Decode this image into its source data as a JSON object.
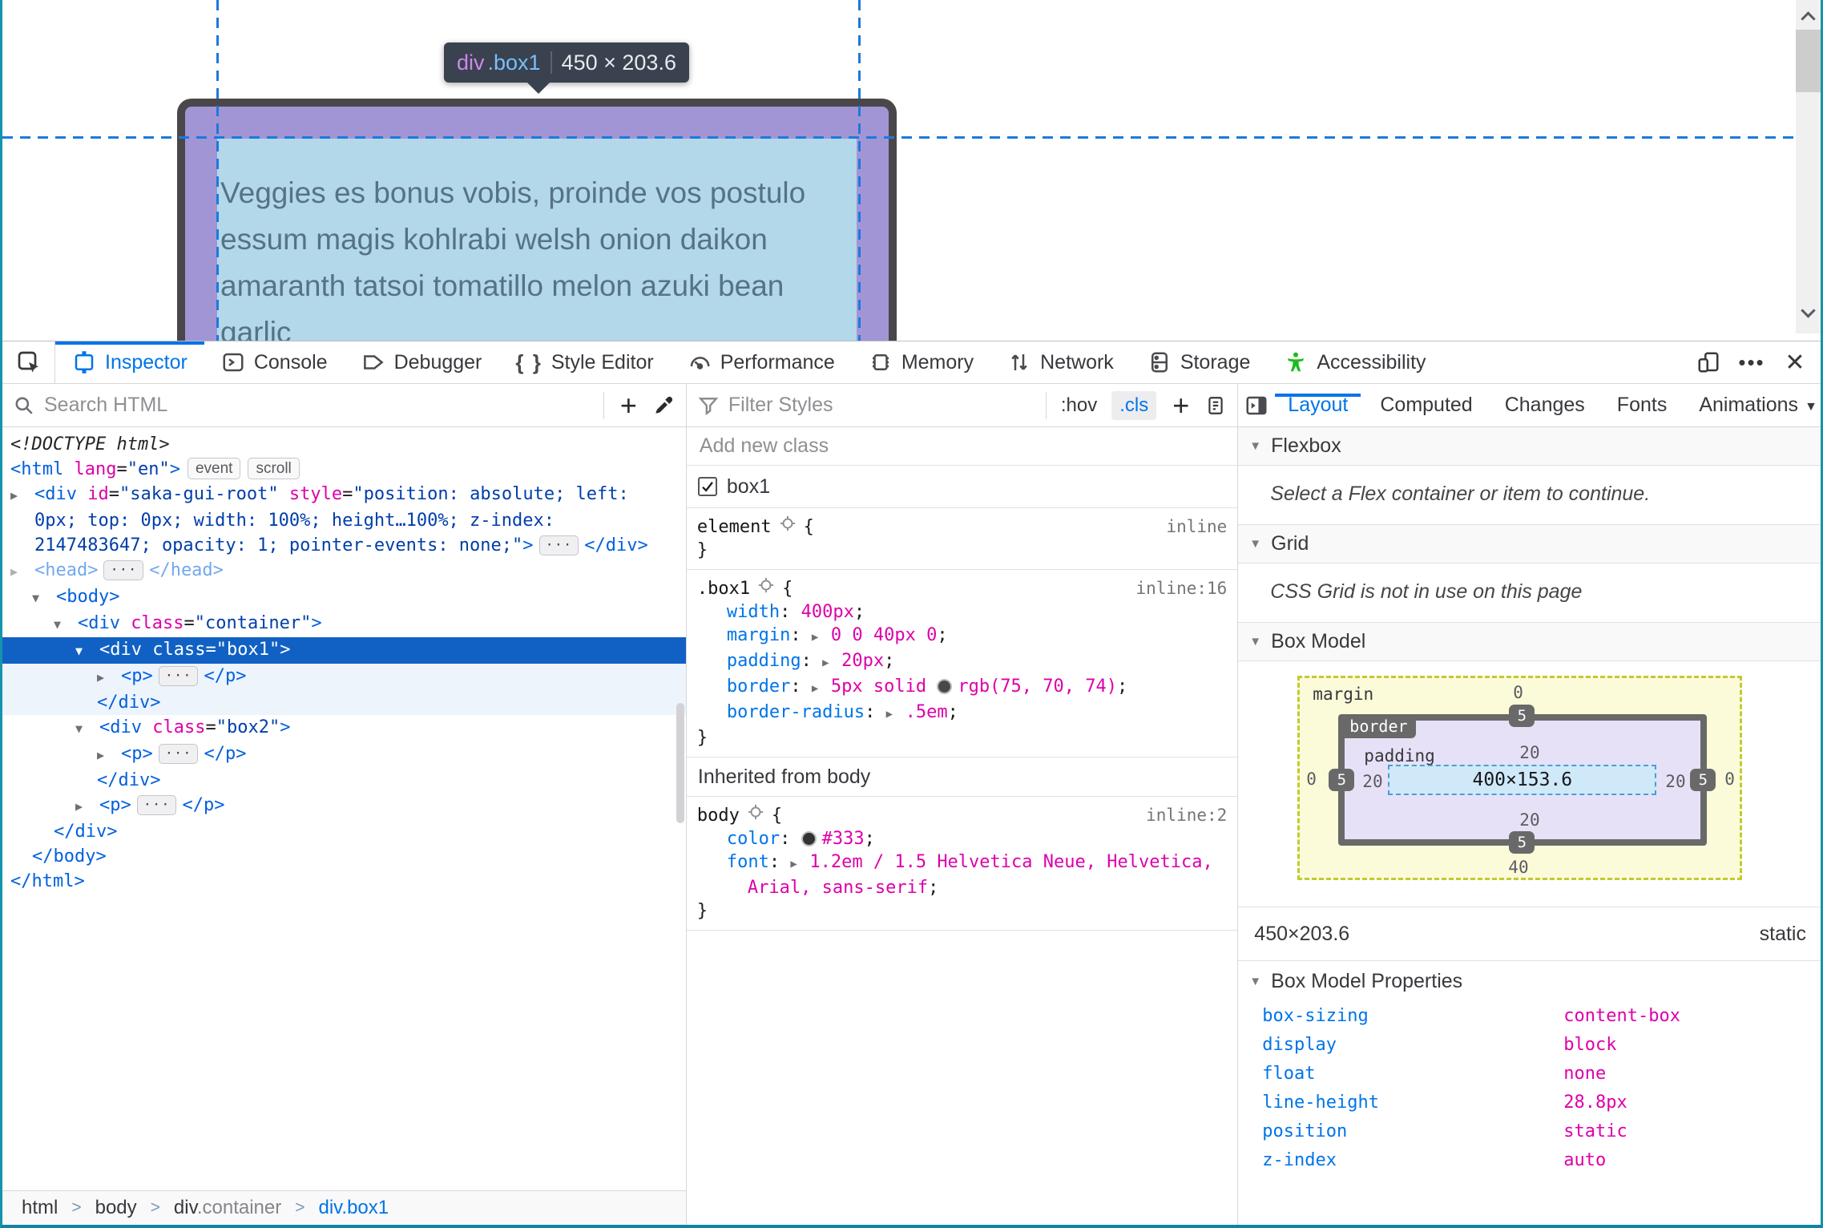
{
  "viewport": {
    "tooltip": {
      "tag": "div",
      "cls": ".box1",
      "sep": "|",
      "dims": "450 × 203.6"
    },
    "page_text_lines": [
      "Veggies es bonus vobis, proinde vos postulo",
      "essum magis kohlrabi welsh onion daikon",
      "amaranth tatsoi tomatillo melon azuki bean",
      "garlic"
    ]
  },
  "toolbox_tabs": {
    "items": [
      {
        "id": "inspector",
        "label": "Inspector",
        "active": true
      },
      {
        "id": "console",
        "label": "Console"
      },
      {
        "id": "debugger",
        "label": "Debugger"
      },
      {
        "id": "style-editor",
        "label": "Style Editor"
      },
      {
        "id": "performance",
        "label": "Performance"
      },
      {
        "id": "memory",
        "label": "Memory"
      },
      {
        "id": "network",
        "label": "Network"
      },
      {
        "id": "storage",
        "label": "Storage"
      },
      {
        "id": "accessibility",
        "label": "Accessibility"
      }
    ],
    "overflow_dots": "•••",
    "close": "✕"
  },
  "markup": {
    "search_placeholder": "Search HTML",
    "tree": [
      {
        "indent": 0,
        "arrow": null,
        "tokens": [
          {
            "t": "doctype",
            "v": "<!DOCTYPE html>"
          }
        ]
      },
      {
        "indent": 0,
        "arrow": null,
        "tokens": [
          {
            "t": "tag",
            "v": "<html"
          },
          {
            "t": "attr",
            "v": " lang"
          },
          {
            "t": "plain",
            "v": "="
          },
          {
            "t": "val",
            "v": "\"en\""
          },
          {
            "t": "tag",
            "v": ">"
          },
          {
            "t": "badge",
            "v": "event"
          },
          {
            "t": "badge",
            "v": "scroll"
          }
        ]
      },
      {
        "indent": 0,
        "arrow": "closed",
        "tokens": [
          {
            "t": "tag",
            "v": "<div"
          },
          {
            "t": "attr",
            "v": " id"
          },
          {
            "t": "plain",
            "v": "="
          },
          {
            "t": "val",
            "v": "\"saka-gui-root\""
          },
          {
            "t": "attr",
            "v": " style"
          },
          {
            "t": "plain",
            "v": "="
          },
          {
            "t": "val",
            "v": "\"position: absolute; left: 0px; top: 0px; width: 100%; height…100%; z-index: 2147483647; opacity: 1; pointer-events: none;\""
          },
          {
            "t": "tag",
            "v": ">"
          },
          {
            "t": "pill",
            "v": "···"
          },
          {
            "t": "tag",
            "v": "</div>"
          }
        ]
      },
      {
        "indent": 0,
        "arrow": "closed",
        "dim": true,
        "tokens": [
          {
            "t": "tag",
            "v": "<head>"
          },
          {
            "t": "pill",
            "v": "···"
          },
          {
            "t": "tag",
            "v": "</head>"
          }
        ]
      },
      {
        "indent": 1,
        "arrow": "open",
        "tokens": [
          {
            "t": "tag",
            "v": "<body>"
          }
        ]
      },
      {
        "indent": 2,
        "arrow": "open",
        "tokens": [
          {
            "t": "tag",
            "v": "<div"
          },
          {
            "t": "attr",
            "v": " class"
          },
          {
            "t": "plain",
            "v": "="
          },
          {
            "t": "val",
            "v": "\"container\""
          },
          {
            "t": "tag",
            "v": ">"
          }
        ]
      },
      {
        "indent": 3,
        "arrow": "open",
        "state": "selected",
        "tokens": [
          {
            "t": "tag",
            "v": "<div"
          },
          {
            "t": "attr",
            "v": " class"
          },
          {
            "t": "plain",
            "v": "="
          },
          {
            "t": "val",
            "v": "\"box1\""
          },
          {
            "t": "tag",
            "v": ">"
          }
        ]
      },
      {
        "indent": 4,
        "arrow": "closed",
        "state": "child",
        "tokens": [
          {
            "t": "tag",
            "v": "<p>"
          },
          {
            "t": "pill",
            "v": "···"
          },
          {
            "t": "tag",
            "v": "</p>"
          }
        ]
      },
      {
        "indent": 4,
        "arrow": null,
        "state": "child",
        "tokens": [
          {
            "t": "tag",
            "v": "</div>"
          }
        ]
      },
      {
        "indent": 3,
        "arrow": "open",
        "tokens": [
          {
            "t": "tag",
            "v": "<div"
          },
          {
            "t": "attr",
            "v": " class"
          },
          {
            "t": "plain",
            "v": "="
          },
          {
            "t": "val",
            "v": "\"box2\""
          },
          {
            "t": "tag",
            "v": ">"
          }
        ]
      },
      {
        "indent": 4,
        "arrow": "closed",
        "tokens": [
          {
            "t": "tag",
            "v": "<p>"
          },
          {
            "t": "pill",
            "v": "···"
          },
          {
            "t": "tag",
            "v": "</p>"
          }
        ]
      },
      {
        "indent": 4,
        "arrow": null,
        "tokens": [
          {
            "t": "tag",
            "v": "</div>"
          }
        ]
      },
      {
        "indent": 3,
        "arrow": "closed",
        "tokens": [
          {
            "t": "tag",
            "v": "<p>"
          },
          {
            "t": "pill",
            "v": "···"
          },
          {
            "t": "tag",
            "v": "</p>"
          }
        ]
      },
      {
        "indent": 2,
        "arrow": null,
        "tokens": [
          {
            "t": "tag",
            "v": "</div>"
          }
        ]
      },
      {
        "indent": 1,
        "arrow": null,
        "tokens": [
          {
            "t": "tag",
            "v": "</body>"
          }
        ]
      },
      {
        "indent": 0,
        "arrow": null,
        "tokens": [
          {
            "t": "tag",
            "v": "</html>"
          }
        ]
      }
    ],
    "breadcrumb": [
      {
        "parts": [
          {
            "v": "html",
            "c": "dark"
          }
        ]
      },
      {
        "parts": [
          {
            "v": "body",
            "c": "dark"
          }
        ]
      },
      {
        "parts": [
          {
            "v": "div",
            "c": "dark"
          },
          {
            "v": ".container",
            "c": "gray"
          }
        ]
      },
      {
        "parts": [
          {
            "v": "div.box1",
            "c": "blue"
          }
        ]
      }
    ],
    "breadcrumb_sep": ">"
  },
  "rules": {
    "filter_placeholder": "Filter Styles",
    "hov_label": ":hov",
    "cls_label": ".cls",
    "add_class_placeholder": "Add new class",
    "class_toggle_label": "box1",
    "sections": [
      {
        "type": "rule",
        "selector": "element",
        "meta": "inline",
        "decls": []
      },
      {
        "type": "rule",
        "selector": ".box1",
        "meta": "inline:16",
        "decls": [
          {
            "name": "width",
            "parts": [
              {
                "text": "400px"
              }
            ]
          },
          {
            "name": "margin",
            "arrow": true,
            "parts": [
              {
                "text": "0 0 40px 0"
              }
            ]
          },
          {
            "name": "padding",
            "arrow": true,
            "parts": [
              {
                "text": "20px"
              }
            ]
          },
          {
            "name": "border",
            "arrow": true,
            "parts": [
              {
                "text": "5px solid "
              },
              {
                "swatch": "#4b464a"
              },
              {
                "text": "rgb(75, 70, 74)"
              }
            ]
          },
          {
            "name": "border-radius",
            "arrow": true,
            "parts": [
              {
                "text": ".5em"
              }
            ]
          }
        ]
      },
      {
        "type": "header",
        "text": "Inherited from body"
      },
      {
        "type": "rule",
        "selector": "body",
        "meta": "inline:2",
        "decls": [
          {
            "name": "color",
            "parts": [
              {
                "swatch": "#333333"
              },
              {
                "text": "#333"
              }
            ]
          },
          {
            "name": "font",
            "arrow": true,
            "parts": [
              {
                "text": "1.2em / 1.5 Helvetica Neue, Helvetica, Arial, sans-serif"
              }
            ]
          }
        ]
      }
    ]
  },
  "layout": {
    "tabs": [
      "Layout",
      "Computed",
      "Changes",
      "Fonts",
      "Animations"
    ],
    "caret": "▼",
    "flexbox": {
      "title": "Flexbox",
      "message": "Select a Flex container or item to continue."
    },
    "grid": {
      "title": "Grid",
      "message": "CSS Grid is not in use on this page"
    },
    "box_model": {
      "title": "Box Model",
      "diagram": {
        "margin_label": "margin",
        "border_label": "border",
        "padding_label": "padding",
        "content_size": "400×153.6",
        "margin_top": "0",
        "margin_left": "0",
        "margin_right": "0",
        "margin_bottom": "40",
        "border_top": "5",
        "border_left": "5",
        "border_right": "5",
        "border_bottom": "5",
        "padding_top": "20",
        "padding_left": "20",
        "padding_right": "20",
        "padding_bottom": "20"
      }
    },
    "dims_row": {
      "size": "450×203.6",
      "position": "static"
    },
    "properties": {
      "title": "Box Model Properties",
      "items": [
        {
          "name": "box-sizing",
          "value": "content-box"
        },
        {
          "name": "display",
          "value": "block"
        },
        {
          "name": "float",
          "value": "none"
        },
        {
          "name": "line-height",
          "value": "28.8px"
        },
        {
          "name": "position",
          "value": "static"
        },
        {
          "name": "z-index",
          "value": "auto"
        }
      ]
    }
  }
}
